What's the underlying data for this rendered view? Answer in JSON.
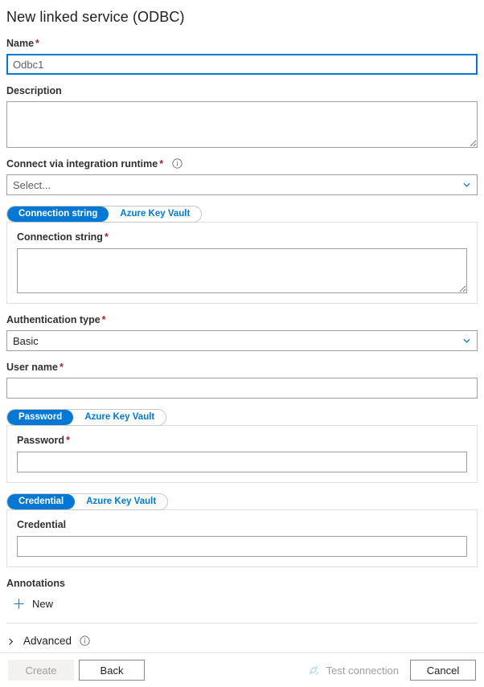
{
  "title": "New linked service (ODBC)",
  "fields": {
    "name": {
      "label": "Name",
      "required": "*",
      "value": "Odbc1",
      "placeholder": "Odbc1"
    },
    "description": {
      "label": "Description",
      "value": "",
      "placeholder": ""
    },
    "integration_runtime": {
      "label": "Connect via integration runtime",
      "required": "*",
      "value": "Select...",
      "info_icon": "info-icon",
      "chevron_icon": "chevron-down-icon"
    },
    "connection_string": {
      "label": "Connection string",
      "required": "*",
      "value": "",
      "placeholder": ""
    },
    "authentication_type": {
      "label": "Authentication type",
      "required": "*",
      "value": "Basic",
      "chevron_icon": "chevron-down-icon"
    },
    "user_name": {
      "label": "User name",
      "required": "*",
      "value": "",
      "placeholder": ""
    },
    "password": {
      "label": "Password",
      "required": "*",
      "value": "",
      "placeholder": ""
    },
    "credential": {
      "label": "Credential",
      "required": "",
      "value": "",
      "placeholder": ""
    }
  },
  "toggles": {
    "connection": {
      "active": "Connection string",
      "inactive": "Azure Key Vault"
    },
    "password": {
      "active": "Password",
      "inactive": "Azure Key Vault"
    },
    "credential": {
      "active": "Credential",
      "inactive": "Azure Key Vault"
    }
  },
  "annotations": {
    "label": "Annotations",
    "new_label": "New",
    "plus_icon": "plus-icon"
  },
  "advanced": {
    "label": "Advanced",
    "chevron_icon": "chevron-right-icon",
    "info_icon": "info-icon"
  },
  "footer": {
    "create_label": "Create",
    "back_label": "Back",
    "test_connection_label": "Test connection",
    "test_connection_icon": "plug-icon",
    "cancel_label": "Cancel"
  },
  "colors": {
    "accent": "#0078d4",
    "required": "#a4262c",
    "border": "#a19f9d",
    "panel_border": "#e1dfdd",
    "disabled_text": "#a19f9d"
  }
}
